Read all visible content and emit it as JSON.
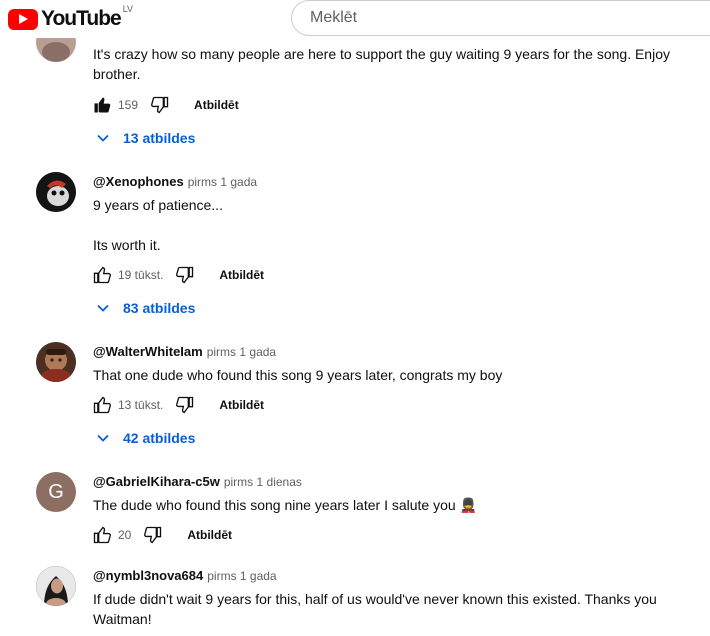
{
  "header": {
    "logo_text": "YouTube",
    "country": "LV",
    "search_placeholder": "Meklēt"
  },
  "comments": [
    {
      "author": "",
      "time": "",
      "text": "It's crazy how so many people are here to support the guy waiting 9 years for the song. Enjoy brother.",
      "likes": "159",
      "liked": true,
      "reply_label": "Atbildēt",
      "replies_label": "13 atbildes"
    },
    {
      "author": "@Xenophones",
      "time": "pirms 1 gada",
      "text": "9 years of patience...\n\nIts worth it.",
      "likes": "19 tūkst.",
      "liked": false,
      "reply_label": "Atbildēt",
      "replies_label": "83 atbildes"
    },
    {
      "author": "@WalterWhiteIam",
      "time": "pirms 1 gada",
      "text": "That one dude who found this song 9 years later, congrats my boy",
      "likes": "13 tūkst.",
      "liked": false,
      "reply_label": "Atbildēt",
      "replies_label": "42 atbildes"
    },
    {
      "author": "@GabrielKihara-c5w",
      "time": "pirms 1 dienas",
      "text": "The dude who found this song nine years later I salute you 💂",
      "likes": "20",
      "liked": false,
      "reply_label": "Atbildēt",
      "avatar_letter": "G"
    },
    {
      "author": "@nymbl3nova684",
      "time": "pirms 1 gada",
      "text": "If dude didn't wait 9 years for this, half of us would've never known this existed. Thanks you Waitman!"
    }
  ],
  "colors": {
    "brand_red": "#ff0000",
    "link_blue": "#065fd4",
    "avatar_g": "#8d6e63"
  }
}
